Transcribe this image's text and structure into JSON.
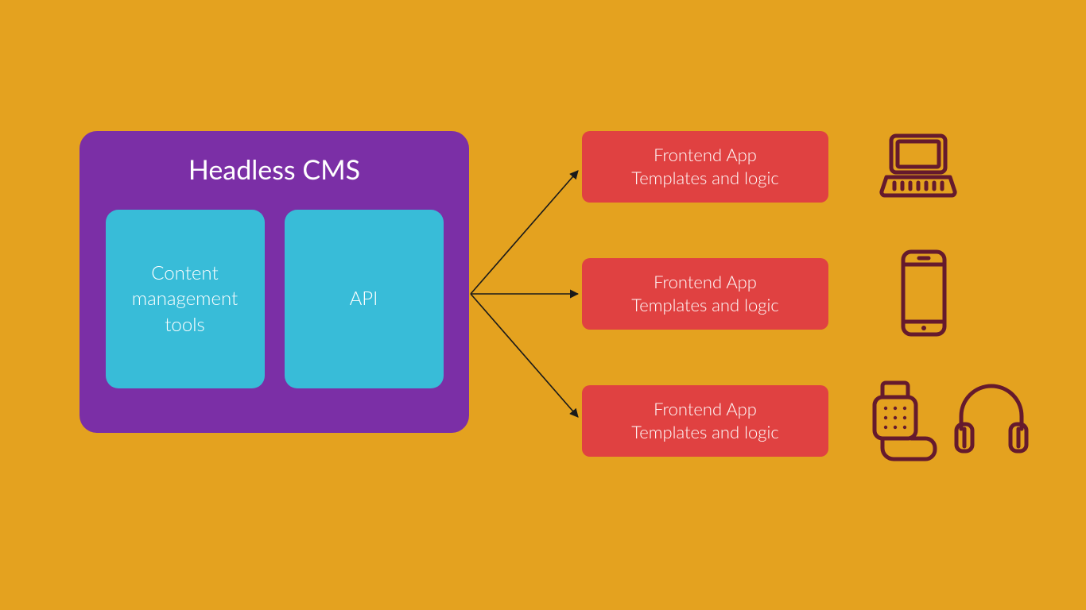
{
  "colors": {
    "background": "#e4a21f",
    "cms_panel": "#7b2fa6",
    "cms_box": "#38bcd8",
    "frontend_box": "#e04141",
    "icon_stroke": "#651a2d"
  },
  "cms": {
    "title": "Headless CMS",
    "boxes": [
      {
        "label": "Content\nmanagement\ntools"
      },
      {
        "label": "API"
      }
    ]
  },
  "frontends": [
    {
      "title": "Frontend App",
      "subtitle": "Templates and logic",
      "devices": [
        "laptop"
      ]
    },
    {
      "title": "Frontend App",
      "subtitle": "Templates and logic",
      "devices": [
        "phone"
      ]
    },
    {
      "title": "Frontend App",
      "subtitle": "Templates and logic",
      "devices": [
        "smartwatch",
        "headphones"
      ]
    }
  ],
  "icons": {
    "laptop": "laptop-icon",
    "phone": "phone-icon",
    "smartwatch": "smartwatch-icon",
    "headphones": "headphones-icon"
  }
}
